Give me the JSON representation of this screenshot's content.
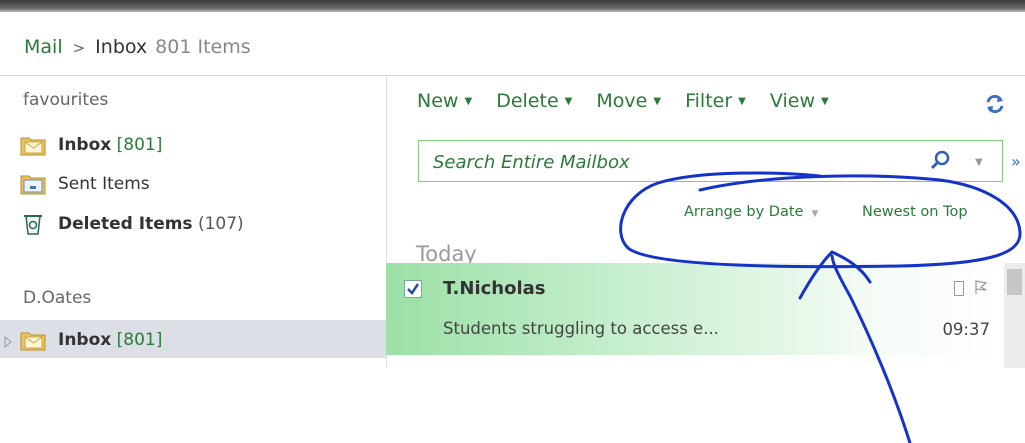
{
  "breadcrumb": {
    "root": "Mail",
    "separator": ">",
    "current": "Inbox",
    "count": "801 Items"
  },
  "nav": {
    "favourites": {
      "title": "favourites",
      "items": [
        {
          "label": "Inbox",
          "count": "[801]",
          "icon": "inbox-folder-icon"
        },
        {
          "label": "Sent Items",
          "count": "",
          "icon": "sent-items-icon"
        },
        {
          "label": "Deleted Items",
          "count": "(107)",
          "icon": "deleted-items-icon"
        }
      ]
    },
    "mailbox": {
      "title": "D.Oates",
      "items": [
        {
          "label": "Inbox",
          "count": "[801]",
          "icon": "inbox-folder-icon",
          "selected": true
        }
      ]
    }
  },
  "toolbar": {
    "new": "New",
    "delete": "Delete",
    "move": "Move",
    "filter": "Filter",
    "view": "View"
  },
  "search": {
    "placeholder": "Search Entire Mailbox"
  },
  "arrange": {
    "by": "Arrange by Date",
    "order": "Newest on Top"
  },
  "list": {
    "group": "Today",
    "messages": [
      {
        "sender": "T.Nicholas",
        "preview": "Students struggling to access e...",
        "time": "09:37",
        "checked": true
      }
    ]
  },
  "colors": {
    "accent": "#2b7a3a",
    "selected_row": "#9be0a6",
    "annotation": "#1533c8",
    "nav_selected": "#dcdfe5"
  }
}
